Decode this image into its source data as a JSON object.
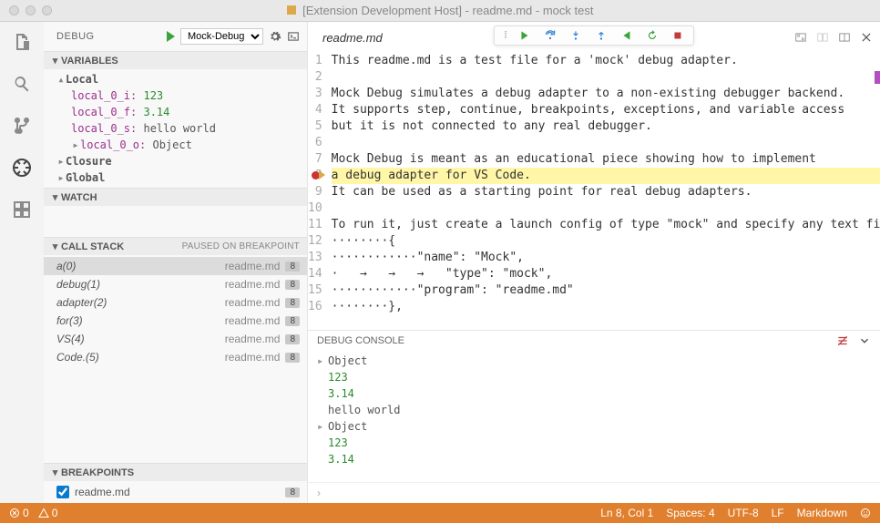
{
  "window": {
    "title": "[Extension Development Host] - readme.md - mock test"
  },
  "sidebar": {
    "debug_header": "DEBUG",
    "config_name": "Mock-Debug",
    "sections": {
      "variables": "VARIABLES",
      "watch": "WATCH",
      "callstack": "CALL STACK",
      "breakpoints": "BREAKPOINTS"
    },
    "variables": {
      "local_label": "Local",
      "closure_label": "Closure",
      "global_label": "Global",
      "items": [
        {
          "name": "local_0_i:",
          "value": "123",
          "type": "num"
        },
        {
          "name": "local_0_f:",
          "value": "3.14",
          "type": "num"
        },
        {
          "name": "local_0_s:",
          "value": "hello world",
          "type": "str"
        },
        {
          "name": "local_0_o:",
          "value": "Object",
          "type": "obj",
          "expandable": true
        }
      ]
    },
    "callstack": {
      "status": "PAUSED ON BREAKPOINT",
      "frames": [
        {
          "name": "a(0)",
          "src": "readme.md",
          "line": "8"
        },
        {
          "name": "debug(1)",
          "src": "readme.md",
          "line": "8"
        },
        {
          "name": "adapter(2)",
          "src": "readme.md",
          "line": "8"
        },
        {
          "name": "for(3)",
          "src": "readme.md",
          "line": "8"
        },
        {
          "name": "VS(4)",
          "src": "readme.md",
          "line": "8"
        },
        {
          "name": "Code.(5)",
          "src": "readme.md",
          "line": "8"
        }
      ]
    },
    "breakpoints": [
      {
        "name": "readme.md",
        "line": "8",
        "checked": true
      }
    ]
  },
  "editor": {
    "tab": "readme.md",
    "lines": [
      "This readme.md is a test file for a 'mock' debug adapter.",
      "",
      "Mock Debug simulates a debug adapter to a non-existing debugger backend.",
      "It supports step, continue, breakpoints, exceptions, and variable access",
      "but it is not connected to any real debugger.",
      "",
      "Mock Debug is meant as an educational piece showing how to implement",
      "a debug adapter for VS Code.",
      "It can be used as a starting point for real debug adapters.",
      "",
      "To run it, just create a launch config of type \"mock\" and specify any text file for the \"program\" attribute.",
      "········{",
      "············\"name\": \"Mock\",",
      "·   →   →   →   \"type\": \"mock\",",
      "············\"program\": \"readme.md\"",
      "········},"
    ],
    "current_line": 8
  },
  "debug_console": {
    "title": "DEBUG CONSOLE",
    "entries": [
      {
        "text": "Object",
        "expandable": true
      },
      {
        "text": "123",
        "cls": "num"
      },
      {
        "text": "3.14",
        "cls": "num"
      },
      {
        "text": "hello world"
      },
      {
        "text": "Object",
        "expandable": true
      },
      {
        "text": "123",
        "cls": "num"
      },
      {
        "text": "3.14",
        "cls": "num"
      }
    ],
    "prompt": "›"
  },
  "statusbar": {
    "errors": "0",
    "warnings": "0",
    "ln_col": "Ln 8, Col 1",
    "spaces": "Spaces: 4",
    "encoding": "UTF-8",
    "eol": "LF",
    "lang": "Markdown"
  }
}
